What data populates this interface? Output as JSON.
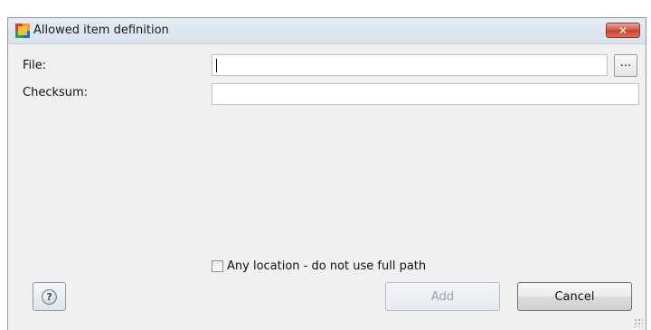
{
  "window": {
    "title": "Allowed item definition",
    "close_label": "✕"
  },
  "form": {
    "file_label": "File:",
    "file_value": "",
    "browse_label": "...",
    "checksum_label": "Checksum:",
    "checksum_value": "",
    "any_location_label": "Any location - do not use full path",
    "any_location_checked": false
  },
  "buttons": {
    "help_label": "?",
    "add_label": "Add",
    "cancel_label": "Cancel"
  },
  "icons": {
    "app": "avg-logo-icon",
    "close": "close-icon",
    "help": "help-icon",
    "browse": "ellipsis-icon",
    "grip": "resize-grip-icon"
  },
  "colors": {
    "titlebar": "#dbe4ef",
    "close_button": "#d3543f",
    "window_bg": "#f0f0f0",
    "disabled_text": "#9aa3ad"
  }
}
